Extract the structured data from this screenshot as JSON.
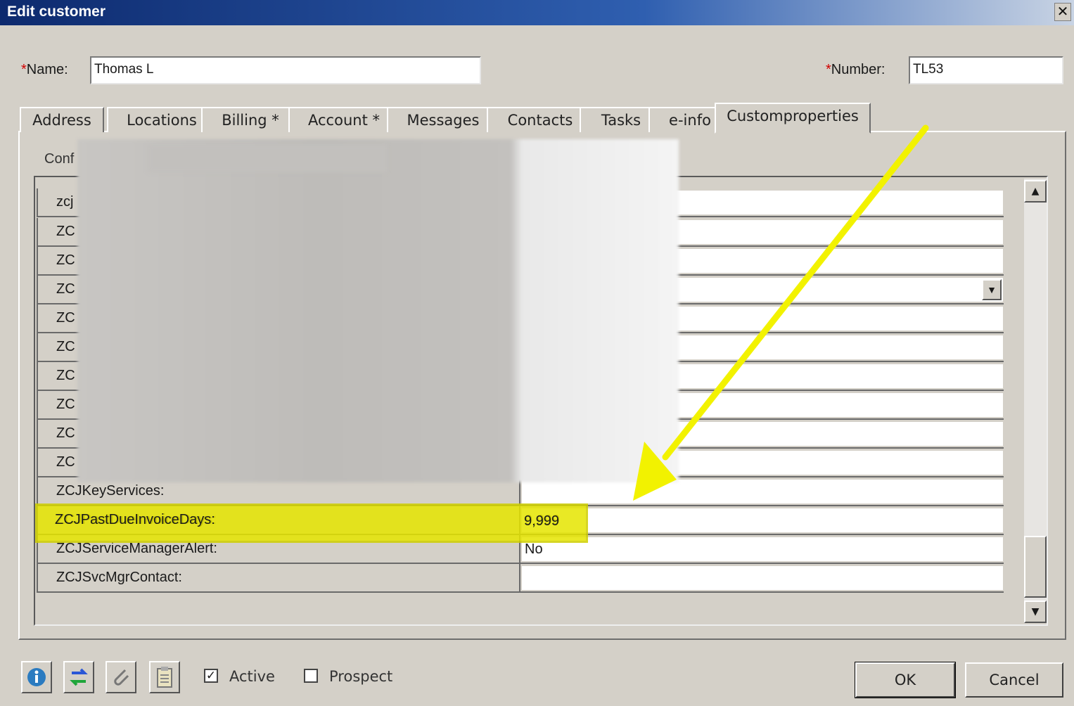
{
  "window": {
    "title": "Edit customer",
    "close_glyph": "✕"
  },
  "form": {
    "name_label": "Name:",
    "name_value": "Thomas L",
    "number_label": "Number:",
    "number_value": "TL53",
    "required_marker": "*"
  },
  "tabs": [
    "Address",
    "Locations",
    "Billing  *",
    "Account *",
    "Messages",
    "Contacts",
    "Tasks",
    "e-info",
    "Customproperties"
  ],
  "active_tab": "Customproperties",
  "panel": {
    "section_label_partial": "Conf"
  },
  "properties": [
    {
      "name": "zcj",
      "value": ""
    },
    {
      "name": "ZC",
      "value": ""
    },
    {
      "name": "ZC",
      "value": ""
    },
    {
      "name": "ZC",
      "value": "",
      "dropdown": true
    },
    {
      "name": "ZC",
      "value": ""
    },
    {
      "name": "ZC",
      "value": ""
    },
    {
      "name": "ZC",
      "value": ""
    },
    {
      "name": "ZC",
      "value": ""
    },
    {
      "name": "ZC",
      "value": ""
    },
    {
      "name": "ZC",
      "value": ""
    },
    {
      "name": "ZCJKeyServices:",
      "value": ""
    },
    {
      "name": "ZCJPastDueInvoiceDays:",
      "value": "9,999"
    },
    {
      "name": "ZCJServiceManagerAlert:",
      "value": "No"
    },
    {
      "name": "ZCJSvcMgrContact:",
      "value": ""
    }
  ],
  "footer": {
    "icons": [
      "info-icon",
      "sync-icon",
      "attachment-icon",
      "clipboard-icon"
    ],
    "active_label": "Active",
    "active_checked": true,
    "prospect_label": "Prospect",
    "prospect_checked": false,
    "ok_label": "OK",
    "cancel_label": "Cancel"
  },
  "colors": {
    "highlight": "#e6e600",
    "arrow": "#f2f200",
    "titlebar": "#0d2a6e"
  }
}
